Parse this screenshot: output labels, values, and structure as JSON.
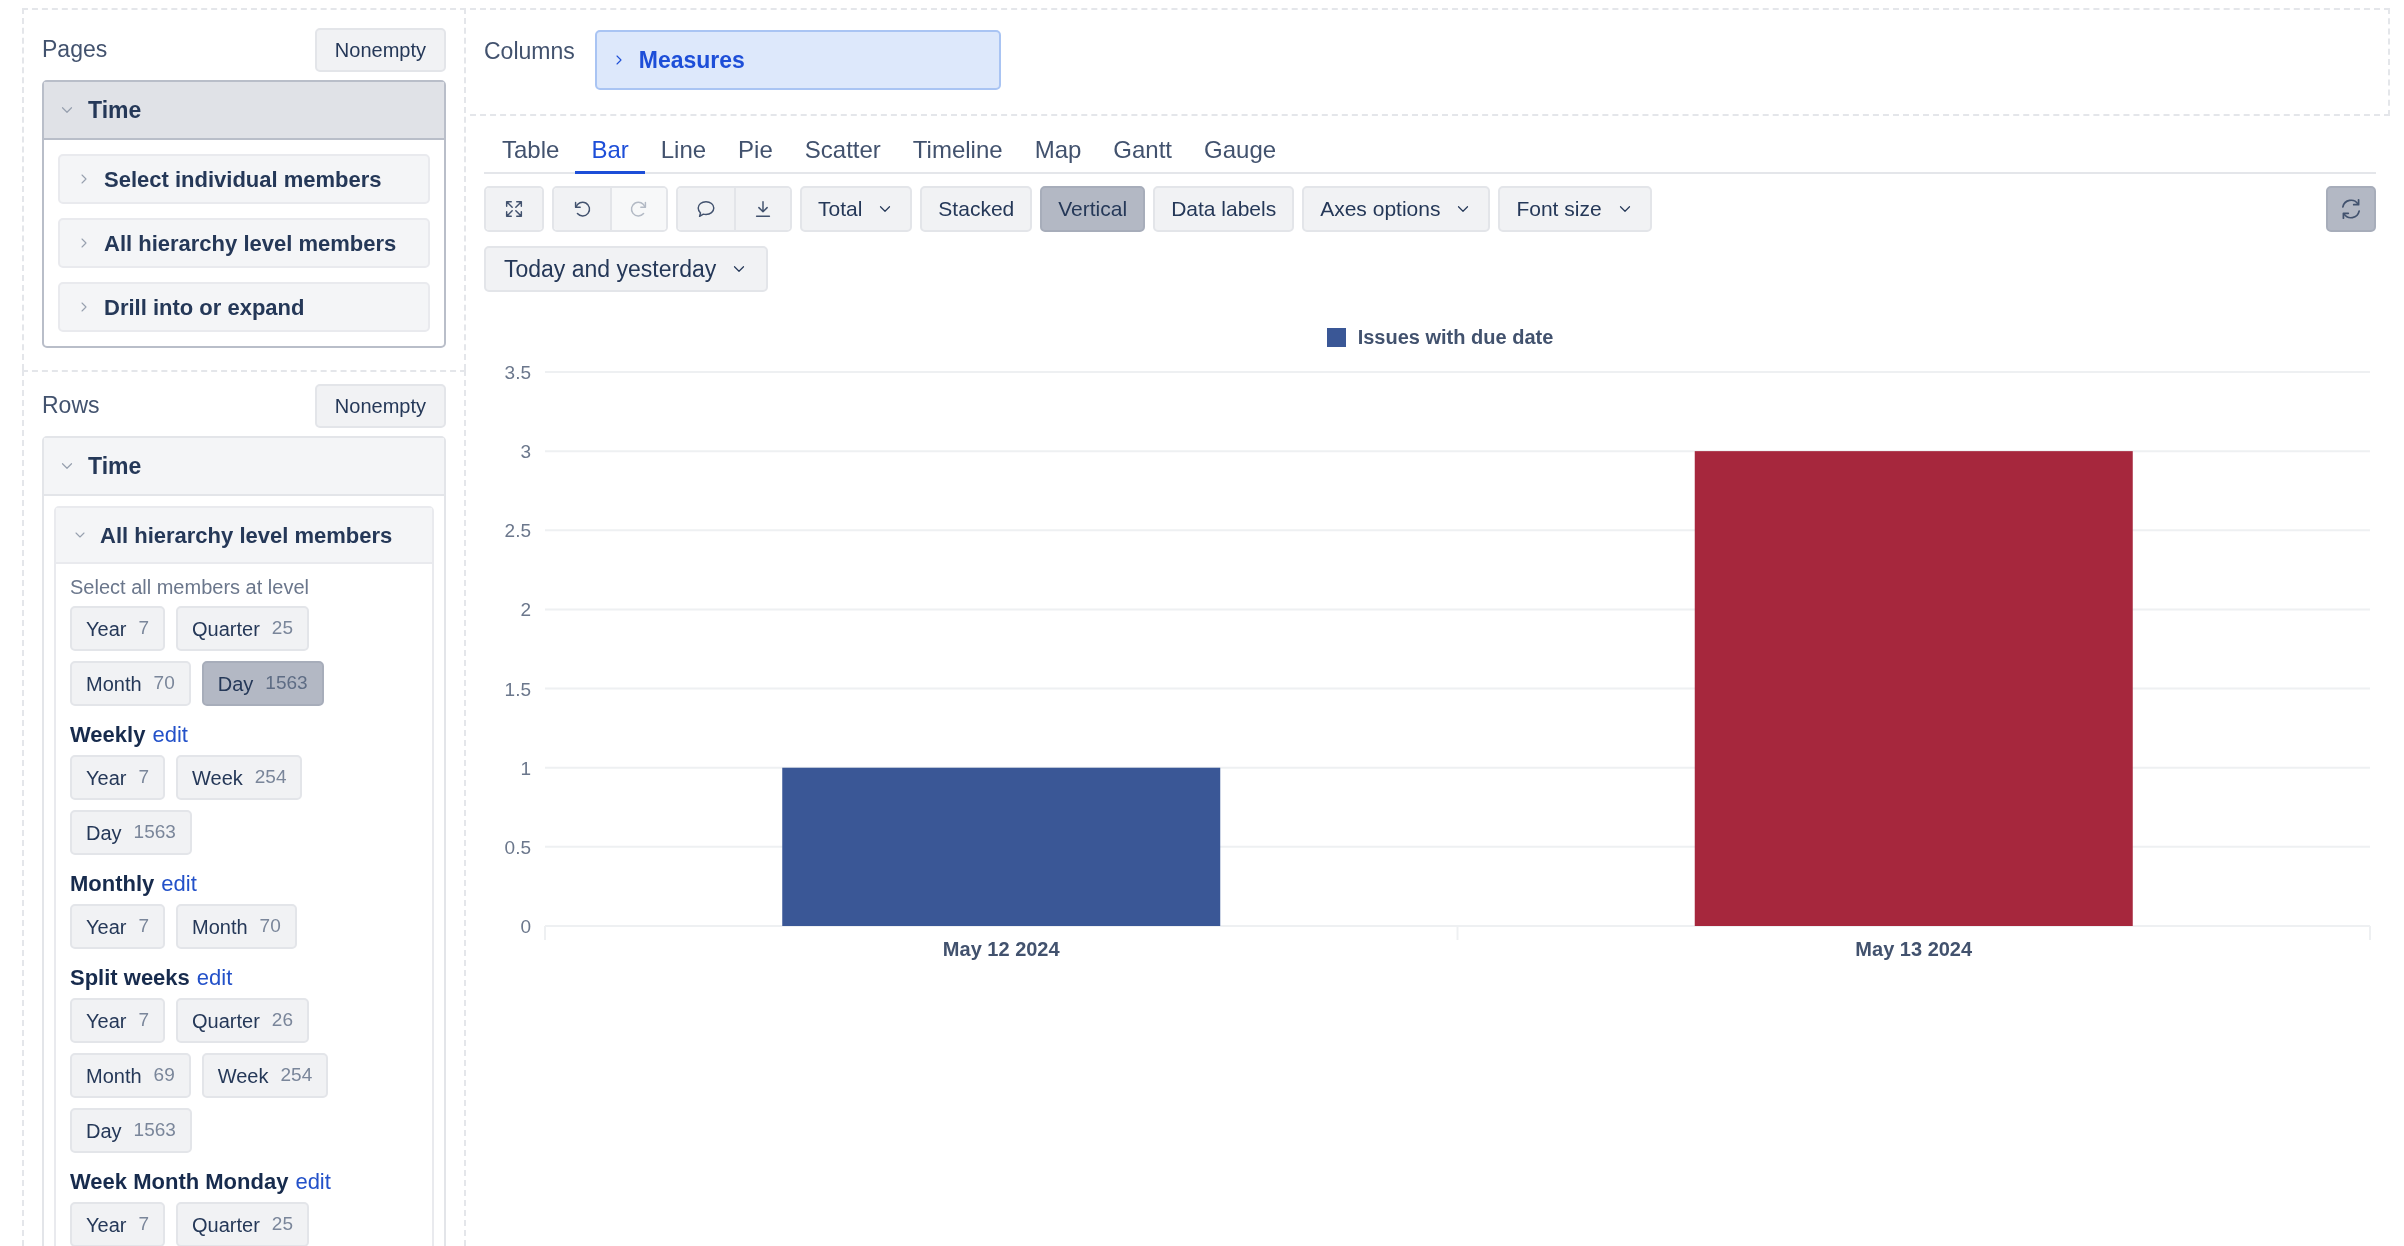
{
  "pages": {
    "title": "Pages",
    "button": "Nonempty",
    "dimension": {
      "name": "Time",
      "expanded": true,
      "highlighted": true,
      "options": [
        {
          "label": "Select individual members",
          "expanded": false
        },
        {
          "label": "All hierarchy level members",
          "expanded": false
        },
        {
          "label": "Drill into or expand",
          "expanded": false
        }
      ]
    }
  },
  "rows": {
    "title": "Rows",
    "button": "Nonempty",
    "dimension": {
      "name": "Time",
      "expanded": true,
      "highlighted": false,
      "sections": [
        {
          "label": "All hierarchy level members",
          "expanded": true,
          "hint": "Select all members at level",
          "groups": [
            {
              "levels": [
                {
                  "label": "Year",
                  "count": "7",
                  "selected": false
                },
                {
                  "label": "Quarter",
                  "count": "25",
                  "selected": false
                },
                {
                  "label": "Month",
                  "count": "70",
                  "selected": false
                },
                {
                  "label": "Day",
                  "count": "1563",
                  "selected": true
                }
              ]
            },
            {
              "name": "Weekly",
              "link": "edit",
              "levels": [
                {
                  "label": "Year",
                  "count": "7",
                  "selected": false
                },
                {
                  "label": "Week",
                  "count": "254",
                  "selected": false
                },
                {
                  "label": "Day",
                  "count": "1563",
                  "selected": false
                }
              ]
            },
            {
              "name": "Monthly",
              "link": "edit",
              "levels": [
                {
                  "label": "Year",
                  "count": "7",
                  "selected": false
                },
                {
                  "label": "Month",
                  "count": "70",
                  "selected": false
                }
              ]
            },
            {
              "name": "Split weeks",
              "link": "edit",
              "levels": [
                {
                  "label": "Year",
                  "count": "7",
                  "selected": false
                },
                {
                  "label": "Quarter",
                  "count": "26",
                  "selected": false
                },
                {
                  "label": "Month",
                  "count": "69",
                  "selected": false
                },
                {
                  "label": "Week",
                  "count": "254",
                  "selected": false
                },
                {
                  "label": "Day",
                  "count": "1563",
                  "selected": false
                }
              ]
            },
            {
              "name": "Week Month Monday",
              "link": "edit",
              "levels": [
                {
                  "label": "Year",
                  "count": "7",
                  "selected": false
                },
                {
                  "label": "Quarter",
                  "count": "25",
                  "selected": false
                }
              ]
            }
          ]
        }
      ]
    }
  },
  "columns": {
    "title": "Columns",
    "dimension": {
      "name": "Measures",
      "expanded": false
    }
  },
  "tabs": [
    {
      "label": "Table",
      "selected": false
    },
    {
      "label": "Bar",
      "selected": true
    },
    {
      "label": "Line",
      "selected": false
    },
    {
      "label": "Pie",
      "selected": false
    },
    {
      "label": "Scatter",
      "selected": false
    },
    {
      "label": "Timeline",
      "selected": false
    },
    {
      "label": "Map",
      "selected": false
    },
    {
      "label": "Gantt",
      "selected": false
    },
    {
      "label": "Gauge",
      "selected": false
    }
  ],
  "toolbar": [
    {
      "kind": "icons",
      "buttons": [
        {
          "disabled": false
        }
      ]
    },
    {
      "kind": "icons",
      "buttons": [
        {
          "disabled": false
        },
        {
          "disabled": true
        }
      ]
    },
    {
      "kind": "icons",
      "buttons": [
        {
          "disabled": false
        },
        {
          "disabled": false
        }
      ]
    },
    {
      "kind": "dropdown",
      "label": "Total"
    },
    {
      "kind": "toggle",
      "label": "Stacked",
      "selected": false
    },
    {
      "kind": "toggle",
      "label": "Vertical",
      "selected": true
    },
    {
      "kind": "toggle",
      "label": "Data labels",
      "selected": false
    },
    {
      "kind": "dropdown",
      "label": "Axes options"
    },
    {
      "kind": "dropdown",
      "label": "Font size"
    }
  ],
  "refresh": {
    "selected": true
  },
  "period": {
    "label": "Today and yesterday"
  },
  "chart": {
    "chart_data": {
      "type": "bar",
      "categories": [
        "May 12 2024",
        "May 13 2024"
      ],
      "series": [
        {
          "name": "Issues with due date",
          "color": "#3a5796",
          "values": [
            1,
            null
          ]
        },
        {
          "color": "#a6273d",
          "values": [
            null,
            3
          ]
        }
      ],
      "grid": true,
      "ylim": [
        0,
        3.5
      ],
      "yticks": [
        0,
        0.5,
        1,
        1.5,
        2,
        2.5,
        3,
        3.5
      ]
    }
  }
}
